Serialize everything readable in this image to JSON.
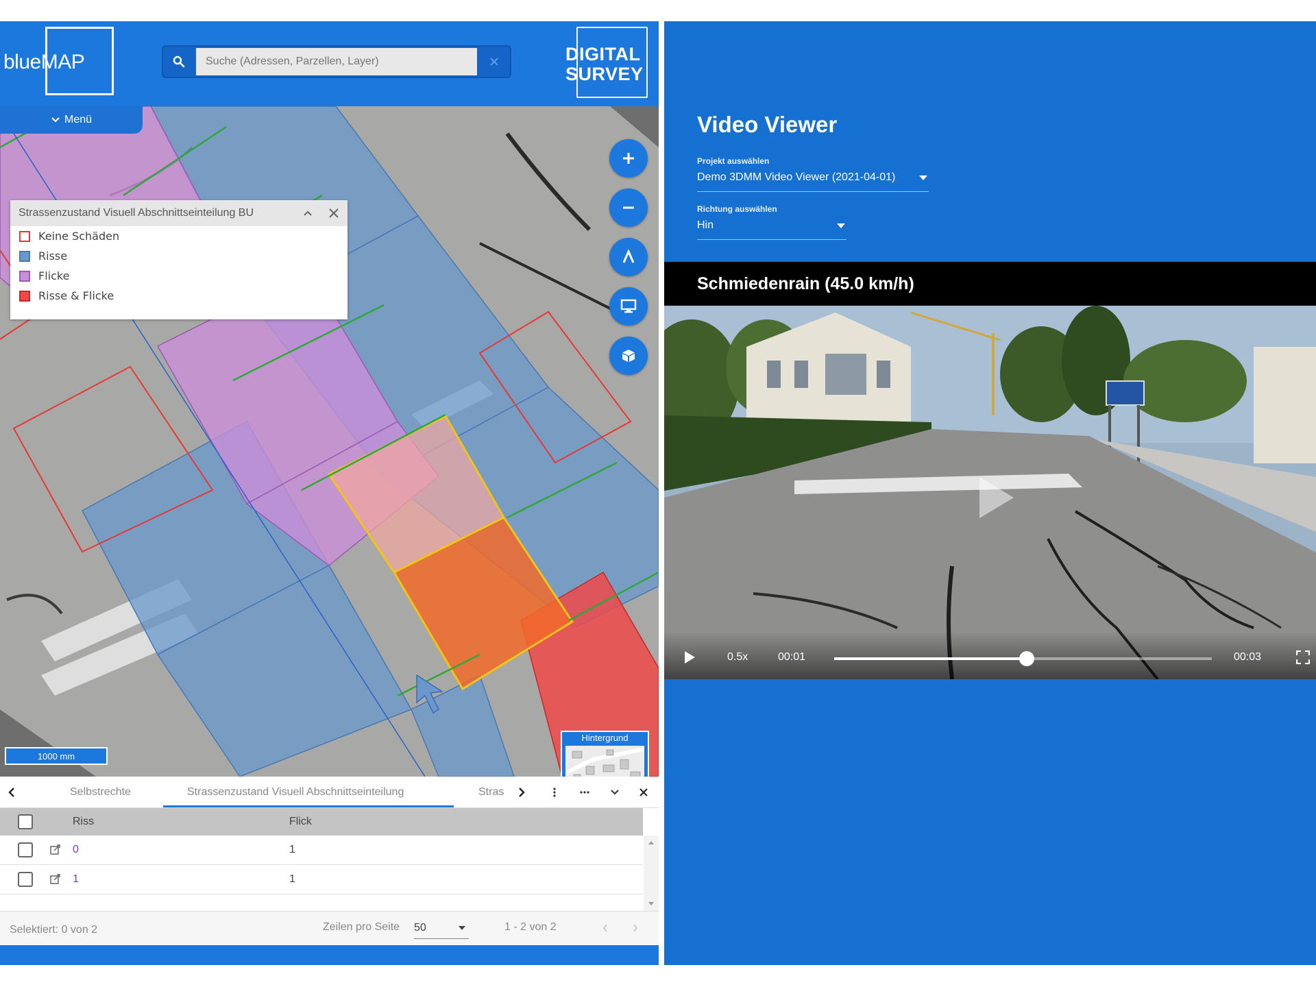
{
  "header": {
    "logo": "blueMAP",
    "search_placeholder": "Suche (Adressen, Parzellen, Layer)",
    "brand_line1": "DIGITAL",
    "brand_line2": "SURVEY"
  },
  "map": {
    "menu_label": "Menü",
    "scale_label": "1000 mm",
    "background_label": "Hintergrund",
    "controls": [
      "plus-icon",
      "minus-icon",
      "north-arrow-icon",
      "monitor-icon",
      "cube-icon"
    ]
  },
  "legend": {
    "title": "Strassenzustand Visuell Abschnittseinteilung BU",
    "items": [
      {
        "label": "Keine Schäden",
        "border": "#e53935",
        "fill": "#ffffff"
      },
      {
        "label": "Risse",
        "border": "#4a78b0",
        "fill": "#6a98cc"
      },
      {
        "label": "Flicke",
        "border": "#9b5bb5",
        "fill": "#c98fd8"
      },
      {
        "label": "Risse & Flicke",
        "border": "#c62828",
        "fill": "#ef4a4a"
      }
    ]
  },
  "table": {
    "tabs": [
      "Selbstrechte",
      "Strassenzustand Visuell Abschnittseinteilung",
      "Stras"
    ],
    "columns": [
      "Riss",
      "Flick"
    ],
    "rows": [
      {
        "riss": "0",
        "flick": "1"
      },
      {
        "riss": "1",
        "flick": "1"
      }
    ],
    "selected": "Selektiert: 0 von 2",
    "rows_per_page_label": "Zeilen pro Seite",
    "rows_per_page": "50",
    "range": "1 - 2 von 2"
  },
  "video_viewer": {
    "title": "Video Viewer",
    "project_label": "Projekt auswählen",
    "project_value": "Demo 3DMM Video Viewer (2021-04-01)",
    "direction_label": "Richtung auswählen",
    "direction_value": "Hin",
    "street_title": "Schmiedenrain (45.0 km/h)",
    "speed": "0.5x",
    "current_time": "00:01",
    "duration": "00:03",
    "progress": 0.51
  },
  "colors": {
    "accent": "#1c78dc",
    "selection": "#f0c419"
  }
}
